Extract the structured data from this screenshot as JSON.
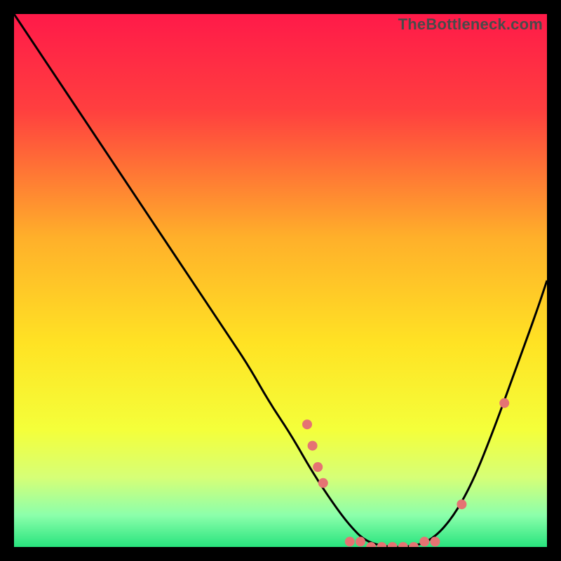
{
  "watermark": "TheBottleneck.com",
  "chart_data": {
    "type": "line",
    "title": "",
    "xlabel": "",
    "ylabel": "",
    "xlim": [
      0,
      100
    ],
    "ylim": [
      0,
      100
    ],
    "background_gradient": {
      "stops": [
        {
          "offset": 0.0,
          "color": "#ff1a49"
        },
        {
          "offset": 0.18,
          "color": "#ff3f3f"
        },
        {
          "offset": 0.42,
          "color": "#ffb02a"
        },
        {
          "offset": 0.62,
          "color": "#ffe324"
        },
        {
          "offset": 0.78,
          "color": "#f4ff3a"
        },
        {
          "offset": 0.87,
          "color": "#d6ff77"
        },
        {
          "offset": 0.94,
          "color": "#8cffab"
        },
        {
          "offset": 1.0,
          "color": "#28e47e"
        }
      ]
    },
    "series": [
      {
        "name": "bottleneck-curve",
        "color": "#000000",
        "x": [
          0,
          4,
          8,
          12,
          16,
          20,
          24,
          28,
          32,
          36,
          40,
          44,
          48,
          52,
          56,
          60,
          63,
          66,
          70,
          74,
          78,
          82,
          86,
          90,
          94,
          98,
          100
        ],
        "y": [
          100,
          94,
          88,
          82,
          76,
          70,
          64,
          58,
          52,
          46,
          40,
          34,
          27,
          21,
          14,
          8,
          4,
          1,
          0,
          0,
          1,
          5,
          12,
          22,
          33,
          44,
          50
        ]
      }
    ],
    "markers": {
      "name": "highlight-points",
      "color": "#e57373",
      "radius": 7,
      "points": [
        {
          "x": 55,
          "y": 23
        },
        {
          "x": 56,
          "y": 19
        },
        {
          "x": 57,
          "y": 15
        },
        {
          "x": 58,
          "y": 12
        },
        {
          "x": 63,
          "y": 1
        },
        {
          "x": 65,
          "y": 1
        },
        {
          "x": 67,
          "y": 0
        },
        {
          "x": 69,
          "y": 0
        },
        {
          "x": 71,
          "y": 0
        },
        {
          "x": 73,
          "y": 0
        },
        {
          "x": 75,
          "y": 0
        },
        {
          "x": 77,
          "y": 1
        },
        {
          "x": 79,
          "y": 1
        },
        {
          "x": 84,
          "y": 8
        },
        {
          "x": 92,
          "y": 27
        }
      ]
    }
  }
}
